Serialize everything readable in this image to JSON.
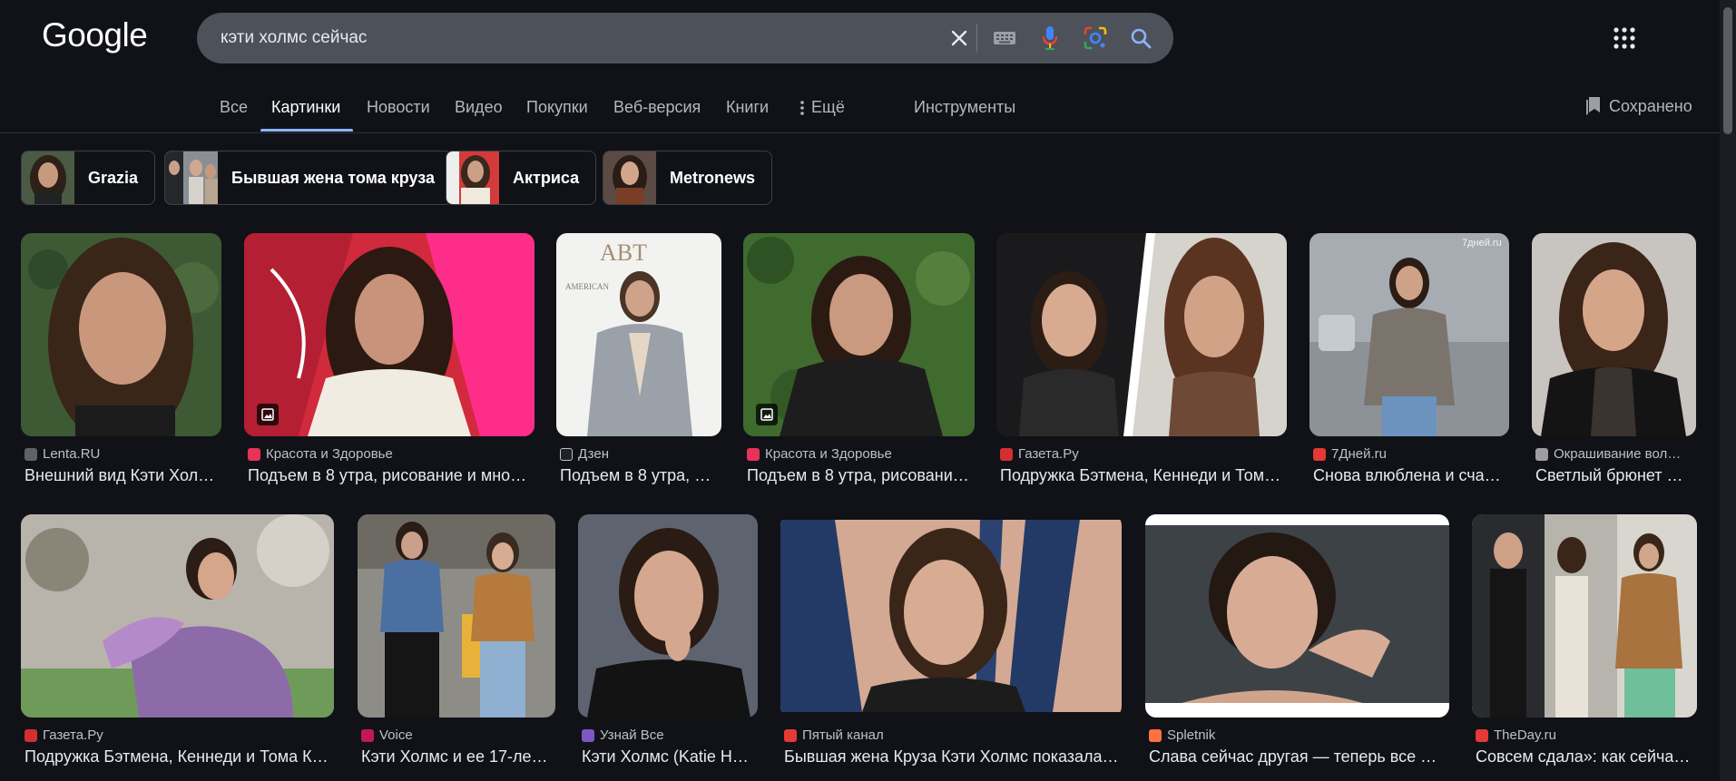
{
  "header": {
    "logo": "Google",
    "search_query": "кэти холмс сейчас",
    "icons": [
      "clear-icon",
      "keyboard-icon",
      "microphone-icon",
      "lens-icon",
      "search-icon",
      "apps-grid-icon"
    ]
  },
  "nav": {
    "tabs": [
      "Все",
      "Картинки",
      "Новости",
      "Видео",
      "Покупки",
      "Веб-версия",
      "Книги",
      "Ещё"
    ],
    "active_tab": "Картинки",
    "tools": "Инструменты",
    "saved": "Сохранено"
  },
  "chips": [
    "Grazia",
    "Бывшая жена тома круза",
    "Актриса",
    "Metronews"
  ],
  "results_row1": [
    {
      "source": "Lenta.RU",
      "title": "Внешний вид Кэти Хол…",
      "fav_color": "#5f6368"
    },
    {
      "source": "Красота и Здоровье",
      "title": "Подъем в 8 утра, рисование и мно…",
      "fav_color": "#e8325a"
    },
    {
      "source": "Дзен",
      "title": "Подъем в 8 утра, …",
      "fav_color": "#202124"
    },
    {
      "source": "Красота и Здоровье",
      "title": "Подъем в 8 утра, рисовани…",
      "fav_color": "#e8325a"
    },
    {
      "source": "Газета.Ру",
      "title": "Подружка Бэтмена, Кеннеди и Том…",
      "fav_color": "#d32f2f"
    },
    {
      "source": "7Дней.ru",
      "title": "Снова влюблена и сча…",
      "fav_color": "#e53935"
    },
    {
      "source": "Окрашивание вол…",
      "title": "Светлый брюнет …",
      "fav_color": "#9e9e9e"
    }
  ],
  "results_row2": [
    {
      "source": "Газета.Ру",
      "title": "Подружка Бэтмена, Кеннеди и Тома К…",
      "fav_color": "#d32f2f"
    },
    {
      "source": "Voice",
      "title": "Кэти Холмс и ее 17-ле…",
      "fav_color": "#c2185b"
    },
    {
      "source": "Узнай Все",
      "title": "Кэти Холмс (Katie H…",
      "fav_color": "#7e57c2"
    },
    {
      "source": "Пятый канал",
      "title": "Бывшая жена Круза Кэти Холмс показала…",
      "fav_color": "#e53935"
    },
    {
      "source": "Spletnik",
      "title": "Слава сейчас другая — теперь все …",
      "fav_color": "#ff7043"
    },
    {
      "source": "TheDay.ru",
      "title": "Совсем сдала»: как сейча…",
      "fav_color": "#e53935"
    }
  ],
  "colors": {
    "background": "#101218",
    "searchbox": "#4d5159",
    "accent": "#8ab4f8",
    "text": "#e8eaed",
    "muted": "#bdc1c6"
  }
}
